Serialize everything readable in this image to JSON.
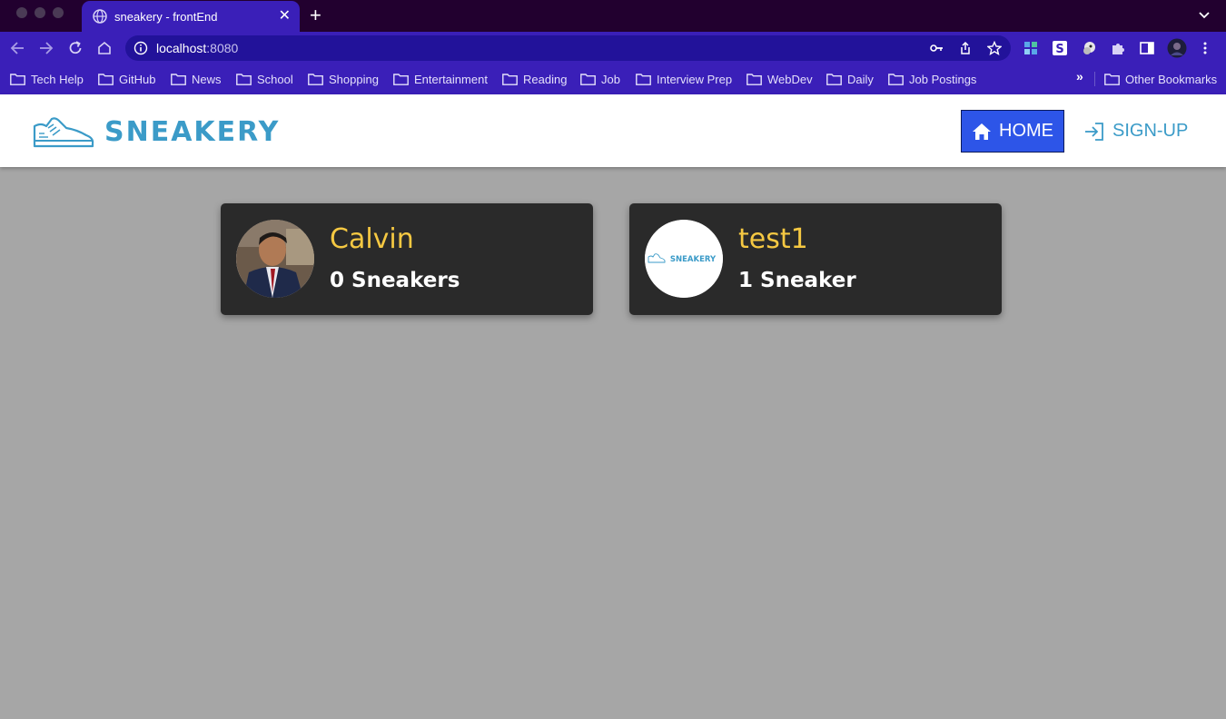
{
  "browser": {
    "tab_title": "sneakery - frontEnd",
    "url_host": "localhost",
    "url_port": ":8080",
    "bookmarks": [
      {
        "label": "Tech Help"
      },
      {
        "label": "GitHub"
      },
      {
        "label": "News"
      },
      {
        "label": "School"
      },
      {
        "label": "Shopping"
      },
      {
        "label": "Entertainment"
      },
      {
        "label": "Reading"
      },
      {
        "label": "Job"
      },
      {
        "label": "Interview Prep"
      },
      {
        "label": "WebDev"
      },
      {
        "label": "Daily"
      },
      {
        "label": "Job Postings"
      }
    ],
    "bookmarks_overflow": "»",
    "other_bookmarks": "Other Bookmarks"
  },
  "site": {
    "logo_text": "SNEAKERY",
    "nav": {
      "home_label": "HOME",
      "signup_label": "SIGN-UP"
    }
  },
  "users": [
    {
      "name": "Calvin",
      "sneaker_count": "0 Sneakers",
      "avatar": "photo"
    },
    {
      "name": "test1",
      "sneaker_count": "1 Sneaker",
      "avatar": "logo",
      "avatar_text": "SNEAKERY"
    }
  ],
  "colors": {
    "chrome_dark": "#22002f",
    "chrome_accent": "#3a1fb8",
    "brand_blue": "#3b9bc8",
    "home_button": "#2d55e8",
    "card_bg": "#2a2a2a",
    "name_yellow": "#f5c842",
    "page_bg": "#a6a6a6"
  }
}
